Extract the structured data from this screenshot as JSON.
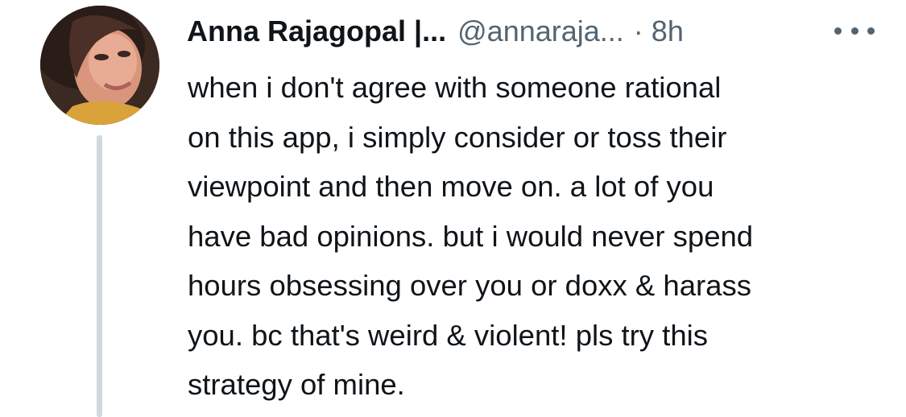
{
  "tweet": {
    "author": {
      "display_name": "Anna Rajagopal |...",
      "handle": "@annaraja...",
      "separator": "·",
      "time": "8h",
      "avatar_icon": "profile-photo"
    },
    "more_icon": "ellipsis-icon",
    "text": "when i don't agree with someone rational\non this app, i simply consider or toss their\nviewpoint and then move on. a lot of you\nhave bad opinions. but i would never spend\nhours obsessing over you or doxx & harass\nyou. bc that's weird & violent! pls try this\nstrategy of mine."
  },
  "colors": {
    "text_primary": "#0f1419",
    "text_secondary": "#536471",
    "thread_line": "#cfd9de",
    "background": "#ffffff"
  }
}
